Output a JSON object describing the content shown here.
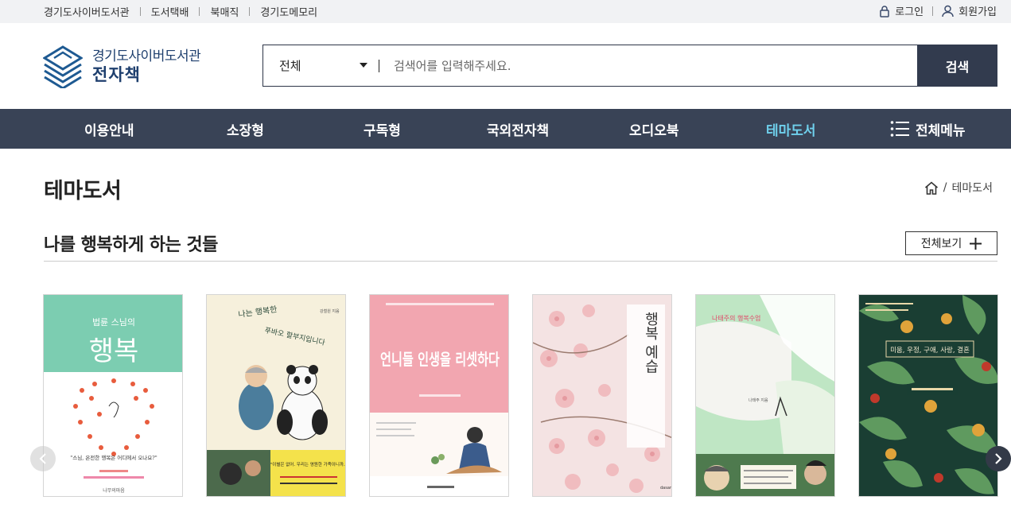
{
  "topbar": {
    "links": [
      "경기도사이버도서관",
      "도서택배",
      "북매직",
      "경기도메모리"
    ],
    "login": "로그인",
    "signup": "회원가입"
  },
  "logo": {
    "line1": "경기도사이버도서관",
    "line2": "전자책"
  },
  "search": {
    "category": "전체",
    "placeholder": "검색어를 입력해주세요.",
    "button": "검색"
  },
  "gnb": {
    "items": [
      "이용안내",
      "소장형",
      "구독형",
      "국외전자책",
      "오디오북",
      "테마도서"
    ],
    "active": "테마도서",
    "all_menu": "전체메뉴",
    "active_color": "#6fd0ec"
  },
  "page": {
    "title": "테마도서",
    "breadcrumb": "테마도서"
  },
  "section": {
    "title": "나를 행복하게 하는 것들",
    "more": "전체보기"
  },
  "books": [
    {
      "cover_text_top": "법륜 스님의",
      "cover_text_main": "행복",
      "cover_quote": "\"스님, 온전한 행복은 어디에서 오나요?\"",
      "publisher": "나무의마음",
      "bg": "#7ccdb1"
    },
    {
      "cover_text_top": "나는 행복한",
      "cover_text_main": "푸바오 할부지입니다",
      "author": "강철원 지음",
      "cover_quote": "\"이별은 없어. 우리는 영원한 가족이니까.\"",
      "bg": "#f6f0dc"
    },
    {
      "cover_text_main": "언니들 인생을 리셋하다",
      "bg": "#f2a6b0"
    },
    {
      "cover_text_main": "행복 예습",
      "bg": "#f4e3e3"
    },
    {
      "cover_text_main": "나태주의 행복수업",
      "author": "나태주 지음",
      "bg": "#bfe6c4"
    },
    {
      "cover_text_main": "미움, 우정, 구애, 사랑, 결혼",
      "bg": "#1a3e33"
    }
  ]
}
